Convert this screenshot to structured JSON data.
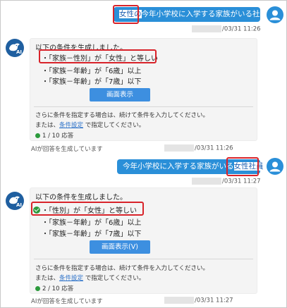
{
  "chat": {
    "user_message_1": {
      "highlight": "女性の",
      "rest": "今年小学校に入学する家族がいる社員",
      "timestamp": "/03/31 11:26"
    },
    "ai_reply_1": {
      "title": "以下の条件を生成しました。",
      "conditions": [
        "・「家族－性別」が「女性」と等しい",
        "・「家族－年齢」が「6歳」以上",
        "・「家族－年齢」が「7歳」以下"
      ],
      "button_label": "画面表示",
      "note_line_1": "さらに条件を指定する場合は、続けて条件を入力してください。",
      "note_line_2_prefix": "または、",
      "note_link": "条件設定",
      "note_line_2_suffix": " で指定してください。",
      "count": "1 / 10 応答",
      "generated_note": "AIが回答を生成しています",
      "timestamp": "/03/31 11:26"
    },
    "user_message_2": {
      "rest": "今年小学校に入学する家族がいる",
      "highlight": "女性社員",
      "timestamp": "/03/31 11:27"
    },
    "ai_reply_2": {
      "title": "以下の条件を生成しました。",
      "conditions": [
        "「性別」が「女性」と等しい",
        "・「家族－年齢」が「6歳」以上",
        "・「家族－年齢」が「7歳」以下"
      ],
      "first_bullet": "・",
      "button_label": "画面表示(V)",
      "note_line_1": "さらに条件を指定する場合は、続けて条件を入力してください。",
      "note_line_2_prefix": "または、",
      "note_link": "条件設定",
      "note_line_2_suffix": " で指定してください。",
      "count": "2 / 10 応答",
      "generated_note": "AIが回答を生成しています",
      "timestamp": "/03/31 11:27"
    },
    "ai_avatar_label": "AI",
    "colors": {
      "accent": "#2a8fd8",
      "highlight": "#d8232a",
      "success": "#2c9a3c"
    }
  }
}
